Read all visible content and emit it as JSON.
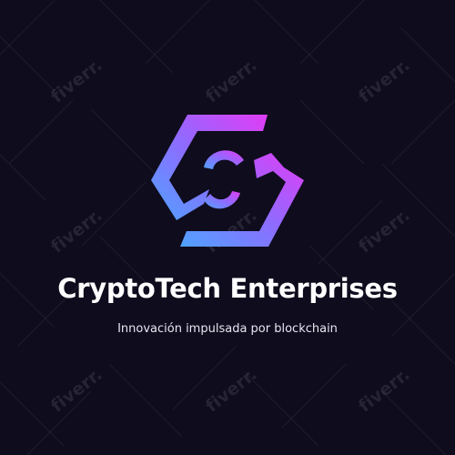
{
  "logo": {
    "brand_name": "CryptoTech Enterprises",
    "tagline": "Innovación impulsada por blockchain",
    "icon": "hexagon-chain-link-icon",
    "gradient_start": "#4fa3ff",
    "gradient_mid": "#8f6bff",
    "gradient_end": "#e23cf5"
  },
  "watermark": {
    "text": "fiverr."
  },
  "colors": {
    "background": "#0e0c1d",
    "brand_text": "#ffffff",
    "tagline_text": "#e8e6f0"
  }
}
